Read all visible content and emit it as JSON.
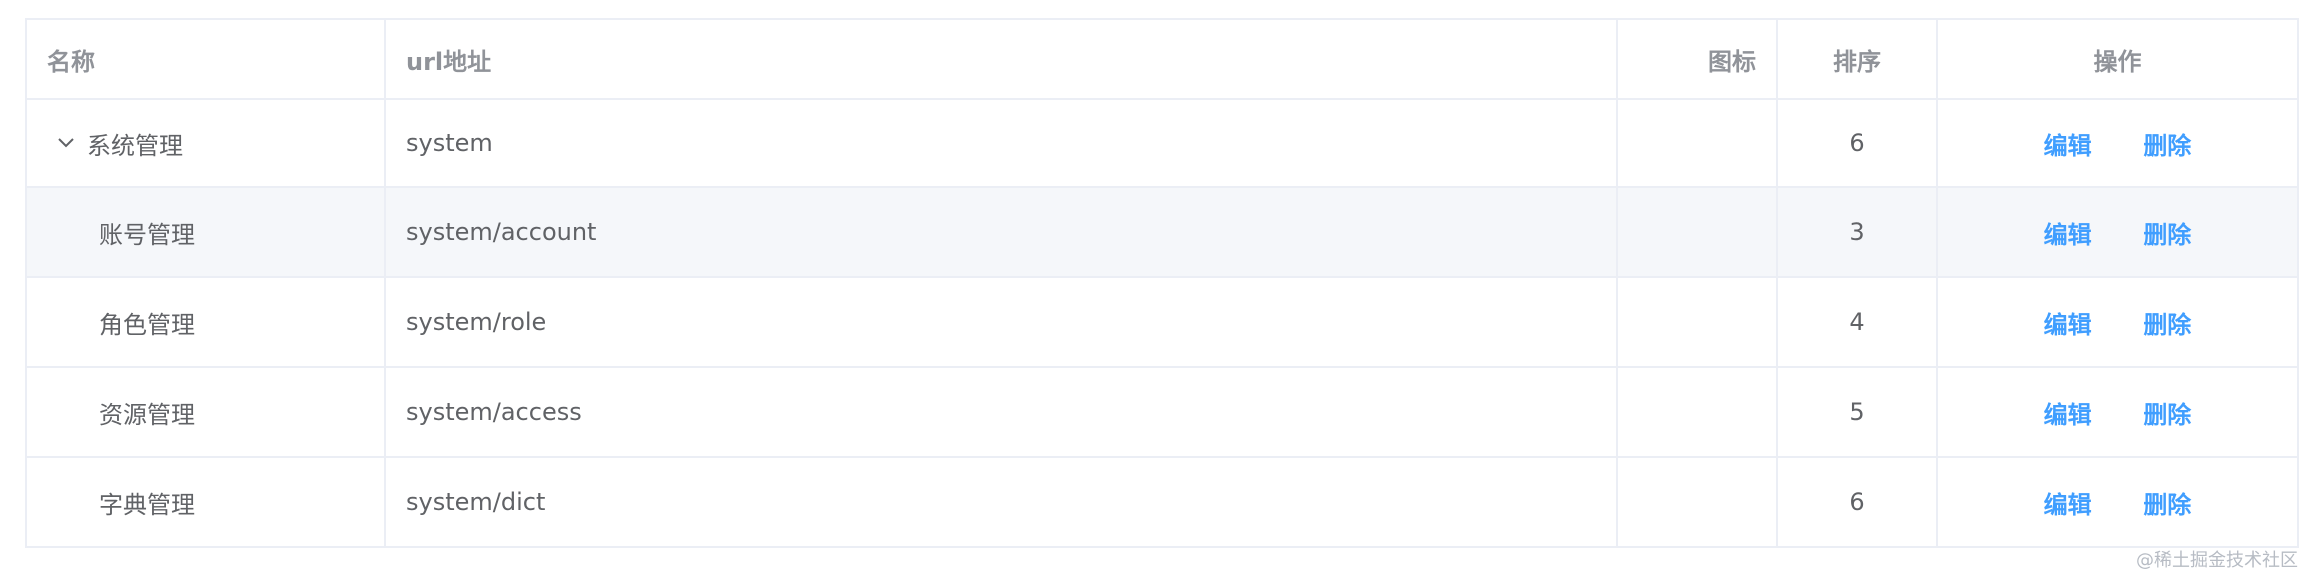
{
  "table": {
    "headers": {
      "name": "名称",
      "url": "url地址",
      "icon": "图标",
      "sort": "排序",
      "ops": "操作"
    },
    "rows": [
      {
        "name": "系统管理",
        "url": "system",
        "icon": "",
        "sort": "6",
        "edit": "编辑",
        "delete": "删除",
        "expanded": true
      },
      {
        "name": "账号管理",
        "url": "system/account",
        "icon": "",
        "sort": "3",
        "edit": "编辑",
        "delete": "删除"
      },
      {
        "name": "角色管理",
        "url": "system/role",
        "icon": "",
        "sort": "4",
        "edit": "编辑",
        "delete": "删除"
      },
      {
        "name": "资源管理",
        "url": "system/access",
        "icon": "",
        "sort": "5",
        "edit": "编辑",
        "delete": "删除"
      },
      {
        "name": "字典管理",
        "url": "system/dict",
        "icon": "",
        "sort": "6",
        "edit": "编辑",
        "delete": "删除"
      }
    ]
  },
  "watermark": "@稀土掘金技术社区",
  "colors": {
    "link": "#409eff",
    "header_text": "#909399",
    "body_text": "#606266",
    "border": "#ebeef5",
    "row_hover": "#f5f7fa"
  },
  "icons": {
    "expand": "chevron-down-icon"
  }
}
